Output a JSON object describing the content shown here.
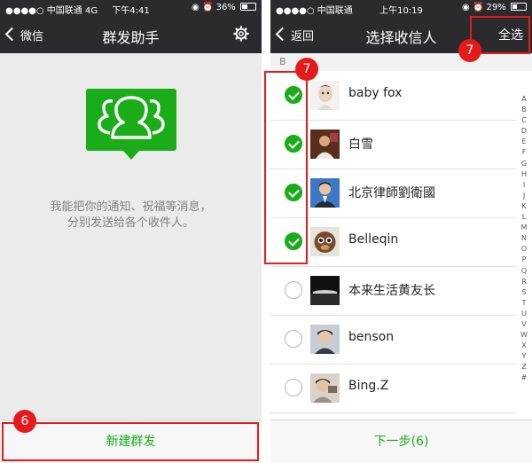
{
  "left": {
    "status": {
      "carrier": "●●●●○ 中国联通 4G",
      "time": "下午4:41",
      "right": "◉ ⏰ 36%",
      "battery_level": 0.36
    },
    "nav": {
      "back": "微信",
      "title": "群发助手",
      "settings_icon": "gear-icon"
    },
    "hero_icon": "group-chat-icon",
    "hint": [
      "我能把你的通知、祝福等消息，",
      "分别发送给各个收件人。"
    ],
    "bottom_button": "新建群发",
    "annotation_badge": "6"
  },
  "right": {
    "status": {
      "carrier": "●●●●○ 中国联通",
      "time": "上午10:19",
      "right": "◉ ⏰ 29%",
      "battery_level": 0.29
    },
    "nav": {
      "back": "返回",
      "title": "选择收信人",
      "select_all": "全选"
    },
    "section_letter": "B",
    "contacts": [
      {
        "name": "baby fox",
        "checked": true
      },
      {
        "name": "白雪",
        "checked": true
      },
      {
        "name": "北京律師劉衛國",
        "checked": true
      },
      {
        "name": "Belleqin",
        "checked": true
      },
      {
        "name": "本来生活黄友长",
        "checked": false
      },
      {
        "name": "benson",
        "checked": false
      },
      {
        "name": "Bing.Z",
        "checked": false
      }
    ],
    "index_letters": [
      "A",
      "B",
      "C",
      "D",
      "E",
      "F",
      "G",
      "H",
      "I",
      "J",
      "K",
      "L",
      "M",
      "N",
      "O",
      "P",
      "Q",
      "R",
      "S",
      "T",
      "U",
      "V",
      "W",
      "X",
      "Y",
      "Z",
      "#"
    ],
    "bottom_button": "下一步(6)",
    "annotation_badges": [
      "7",
      "7"
    ]
  },
  "colors": {
    "navbar": "#2b2b2f",
    "accent_green": "#1aad19",
    "annotation_red": "#e61a1a"
  }
}
